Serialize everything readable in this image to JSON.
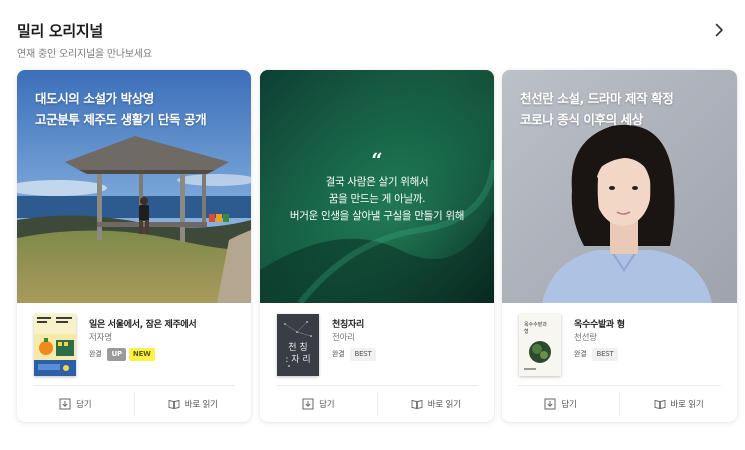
{
  "section": {
    "title": "밀리 오리지널",
    "subtitle": "연재 중인 오리지널을 만나보세요",
    "next_icon": "chevron-right-icon"
  },
  "cards": [
    {
      "headline": [
        "대도시의 소설가 박상영",
        "고군분투 제주도 생활기 단독 공개"
      ],
      "book": {
        "title": "일은 서울에서, 잠은 제주에서",
        "author": "저자명",
        "badges": [
          "완결",
          "UP",
          "NEW"
        ]
      },
      "actions": {
        "save": "담기",
        "read": "바로 읽기"
      }
    },
    {
      "quote_mark": "“",
      "quote": [
        "결국 사람은 살기 위해서",
        "꿈을 만드는 게 아닐까.",
        "버거운 인생을 살아낼 구실을 만들기 위해"
      ],
      "book": {
        "title": "천칭자리",
        "author": "전아리",
        "badges": [
          "완결",
          "BEST"
        ],
        "cover_text": "천칭:자리"
      },
      "actions": {
        "save": "담기",
        "read": "바로 읽기"
      }
    },
    {
      "headline": [
        "천선란 소설, 드라마 제작 확정",
        "코로나 종식 이후의 세상"
      ],
      "book": {
        "title": "옥수수밭과 형",
        "author": "천선랑",
        "badges": [
          "완결",
          "BEST"
        ],
        "cover_text": "옥수수밭과 형"
      },
      "actions": {
        "save": "담기",
        "read": "바로 읽기"
      }
    }
  ],
  "colors": {
    "up_badge": "#9a9a9a",
    "new_badge": "#fff04a",
    "quote_bg": "#0d4a38"
  }
}
